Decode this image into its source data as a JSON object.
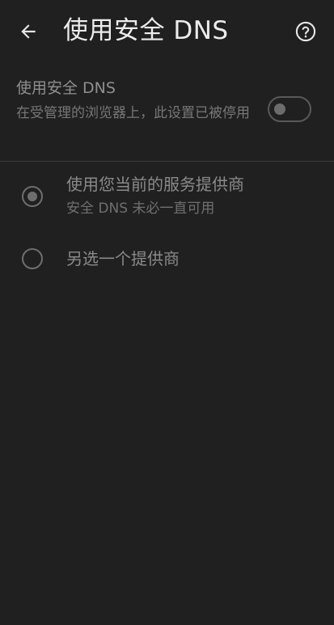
{
  "header": {
    "title": "使用安全 DNS",
    "back_icon": "arrow-left-icon",
    "help_icon": "help-circle-icon"
  },
  "secure_dns": {
    "label": "使用安全 DNS",
    "description": "在受管理的浏览器上，此设置已被停用",
    "enabled": false
  },
  "options": [
    {
      "label": "使用您当前的服务提供商",
      "sublabel": "安全 DNS 未必一直可用",
      "selected": true
    },
    {
      "label": "另选一个提供商",
      "selected": false
    }
  ],
  "colors": {
    "background": "#202020",
    "title_text": "#ececec",
    "disabled_text": "#8a8a8a",
    "divider": "#3b3b3b"
  }
}
